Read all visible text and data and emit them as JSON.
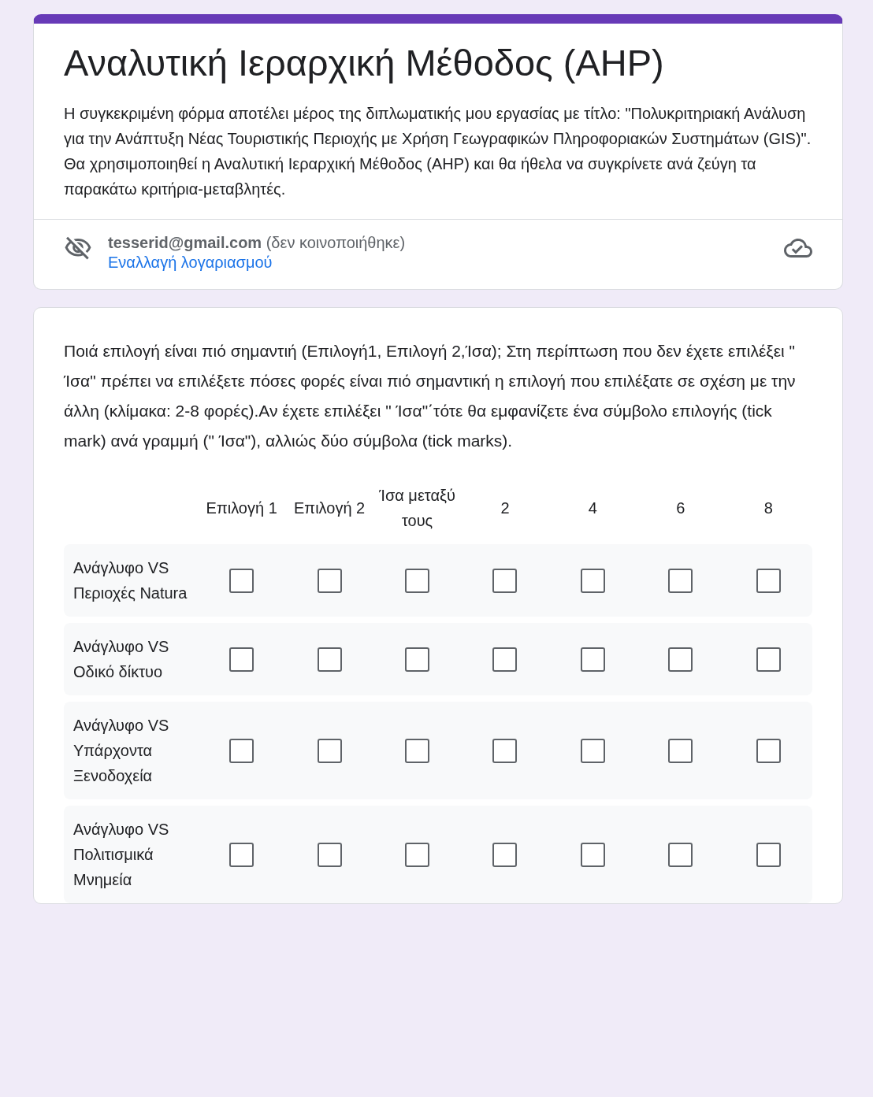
{
  "form": {
    "title": "Αναλυτική Ιεραρχική Μέθοδος (AHP)",
    "description": "Η συγκεκριμένη φόρμα αποτέλει μέρος της διπλωματικής μου εργασίας με τίτλο: \"Πολυκριτηριακή Ανάλυση για την Ανάπτυξη Νέας Τουριστικής Περιοχής με Χρήση Γεωγραφικών Πληροφοριακών Συστημάτων (GIS)\". Θα χρησιμοποιηθεί η Αναλυτική Ιεραρχική Μέθοδος (AHP) και θα ήθελα να συγκρίνετε ανά ζεύγη τα παρακάτω κριτήρια-μεταβλητές.",
    "account": "**tesserid@gmail.com** (δεν κοινοποιήθηκε)",
    "switch_account": "Εναλλαγή λογαριασμού"
  },
  "question": {
    "text": "Ποιά επιλογή είναι πιό σημαντιή (Επιλογή1, Επιλογή 2,Ίσα); Στη περίπτωση που δεν έχετε επιλέξει \" Ίσα\" πρέπει να επιλέξετε πόσες φορές είναι πιό σημαντική η επιλογή που επιλέξατε σε σχέση με την άλλη (κλίμακα: 2-8 φορές).Αν έχετε επιλέξει \" Ίσα\"΄τότε θα εμφανίζετε ένα σύμβολο επιλογής (tick mark) ανά γραμμή (\" Ίσα\"), αλλιώς δύο σύμβολα (tick marks).",
    "columns": [
      "Επιλογή 1",
      "Επιλογή 2",
      "Ίσα μεταξύ τους",
      "2",
      "4",
      "6",
      "8"
    ],
    "rows": [
      {
        "label": "Ανάγλυφο VS Περιοχές Natura",
        "cells": [
          {
            "checked": false
          },
          {
            "checked": false
          },
          {
            "checked": false
          },
          {
            "checked": false
          },
          {
            "checked": false
          },
          {
            "checked": false
          },
          {
            "checked": false
          }
        ]
      },
      {
        "label": "Ανάγλυφο VS Οδικό δίκτυο",
        "cells": [
          {
            "checked": false
          },
          {
            "checked": false
          },
          {
            "checked": false
          },
          {
            "checked": false
          },
          {
            "checked": false
          },
          {
            "checked": false
          },
          {
            "checked": false
          }
        ]
      },
      {
        "label": "Ανάγλυφο VS Υπάρχοντα Ξενοδοχεία",
        "cells": [
          {
            "checked": false
          },
          {
            "checked": false
          },
          {
            "checked": false
          },
          {
            "checked": false
          },
          {
            "checked": false
          },
          {
            "checked": false
          },
          {
            "checked": false
          }
        ]
      },
      {
        "label": "Ανάγλυφο VS Πολιτισμικά Μνημεία",
        "cells": [
          {
            "checked": false
          },
          {
            "checked": false
          },
          {
            "checked": false
          },
          {
            "checked": false
          },
          {
            "checked": false
          },
          {
            "checked": false
          },
          {
            "checked": false
          }
        ]
      }
    ]
  }
}
